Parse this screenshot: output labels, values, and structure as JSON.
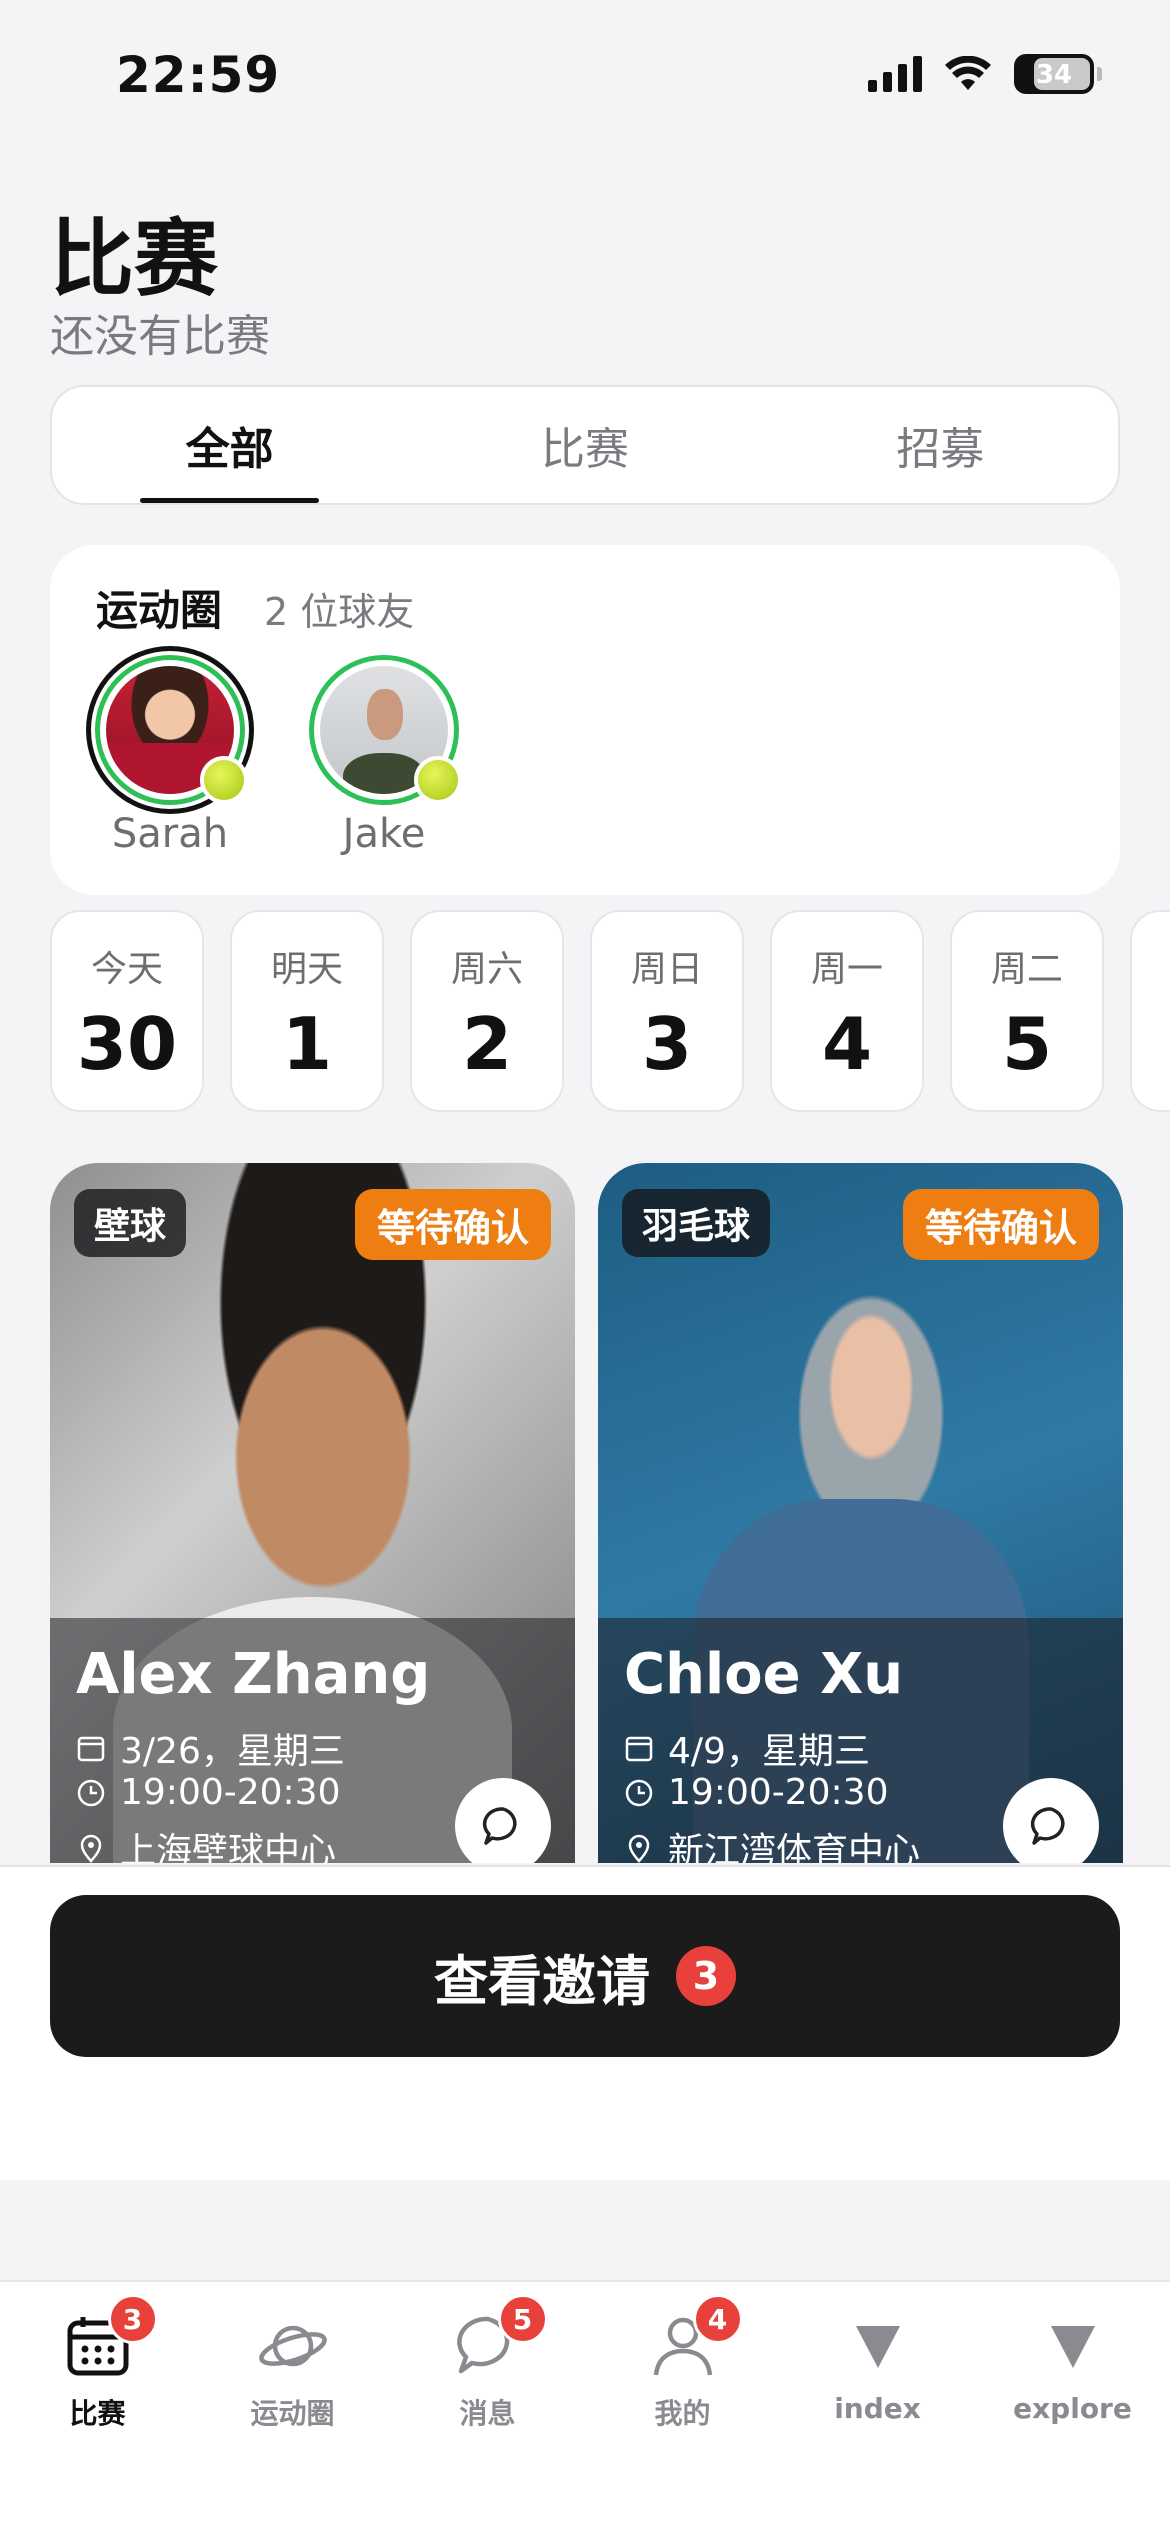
{
  "status_bar": {
    "time": "22:59",
    "battery": "34"
  },
  "header": {
    "title": "比赛",
    "subtitle": "还没有比赛"
  },
  "tabs": [
    {
      "label": "全部",
      "active": true
    },
    {
      "label": "比赛",
      "active": false
    },
    {
      "label": "招募",
      "active": false
    }
  ],
  "circle": {
    "title": "运动圈",
    "count_label": "2 位球友",
    "friends": [
      {
        "name": "Sarah"
      },
      {
        "name": "Jake"
      }
    ]
  },
  "days": [
    {
      "weekday": "今天",
      "date": "30"
    },
    {
      "weekday": "明天",
      "date": "1"
    },
    {
      "weekday": "周六",
      "date": "2"
    },
    {
      "weekday": "周日",
      "date": "3"
    },
    {
      "weekday": "周一",
      "date": "4"
    },
    {
      "weekday": "周二",
      "date": "5"
    }
  ],
  "matches": [
    {
      "sport": "壁球",
      "status": "等待确认",
      "name": "Alex Zhang",
      "date": "3/26，星期三",
      "time": "19:00-20:30",
      "location": "上海壁球中心"
    },
    {
      "sport": "羽毛球",
      "status": "等待确认",
      "name": "Chloe Xu",
      "date": "4/9，星期三",
      "time": "19:00-20:30",
      "location": "新江湾体育中心"
    }
  ],
  "invite": {
    "label": "查看邀请",
    "badge": "3"
  },
  "tabbar": [
    {
      "label": "比赛",
      "icon": "calendar-icon",
      "badge": "3",
      "active": true
    },
    {
      "label": "运动圈",
      "icon": "planet-icon",
      "badge": "",
      "active": false
    },
    {
      "label": "消息",
      "icon": "chat-bubble-icon",
      "badge": "5",
      "active": false
    },
    {
      "label": "我的",
      "icon": "person-icon",
      "badge": "4",
      "active": false
    },
    {
      "label": "index",
      "icon": "triangle-down-icon",
      "badge": "",
      "active": false
    },
    {
      "label": "explore",
      "icon": "triangle-down-icon",
      "badge": "",
      "active": false
    }
  ],
  "colors": {
    "accent_green": "#2fbf57",
    "pending_orange": "#ee7e11",
    "badge_red": "#e8403a",
    "button_dark": "#1b1b1b"
  }
}
